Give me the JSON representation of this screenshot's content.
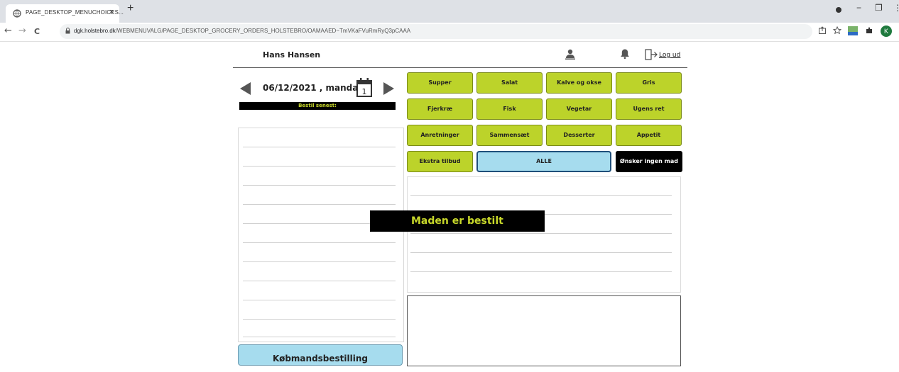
{
  "browser": {
    "tab_title": "PAGE_DESKTOP_MENUCHOICES...",
    "tab_close": "×",
    "new_tab": "+",
    "url_host": "dgk.holstebro.dk",
    "url_path": "/WEBMENUVALG/PAGE_DESKTOP_GROCERY_ORDERS_HOLSTEBRO/OAMAAED~TmVKaFVuRmRyQ3pCAAA",
    "profile_initial": "K",
    "nav_back": "←",
    "nav_forward": "→",
    "nav_reload": "C",
    "min": "−",
    "restore": "❐",
    "close": "⋮"
  },
  "header": {
    "user_name": "Hans Hansen",
    "logout_label": "Log ud"
  },
  "date": {
    "label": "06/12/2021 , mandag",
    "calendar_day": "1",
    "deadline_label": "Bestil senest:"
  },
  "categories": {
    "supper": "Supper",
    "salat": "Salat",
    "kalve": "Kalve og okse",
    "gris": "Gris",
    "fjerkrae": "Fjerkræ",
    "fisk": "Fisk",
    "vegetar": "Vegetar",
    "ugens": "Ugens ret",
    "anretninger": "Anretninger",
    "sammensaet": "Sammensæt",
    "desserter": "Desserter",
    "appetit": "Appetit",
    "ekstra": "Ekstra tilbud",
    "alle": "ALLE",
    "ingen": "Ønsker ingen mad"
  },
  "overlay": {
    "ordered": "Maden er bestilt"
  },
  "bottom": {
    "grocery_button": "Købmandsbestilling"
  },
  "colors": {
    "accent_green": "#bcd32a",
    "accent_blue": "#a6dcee",
    "banner_text": "#c8d82a"
  }
}
